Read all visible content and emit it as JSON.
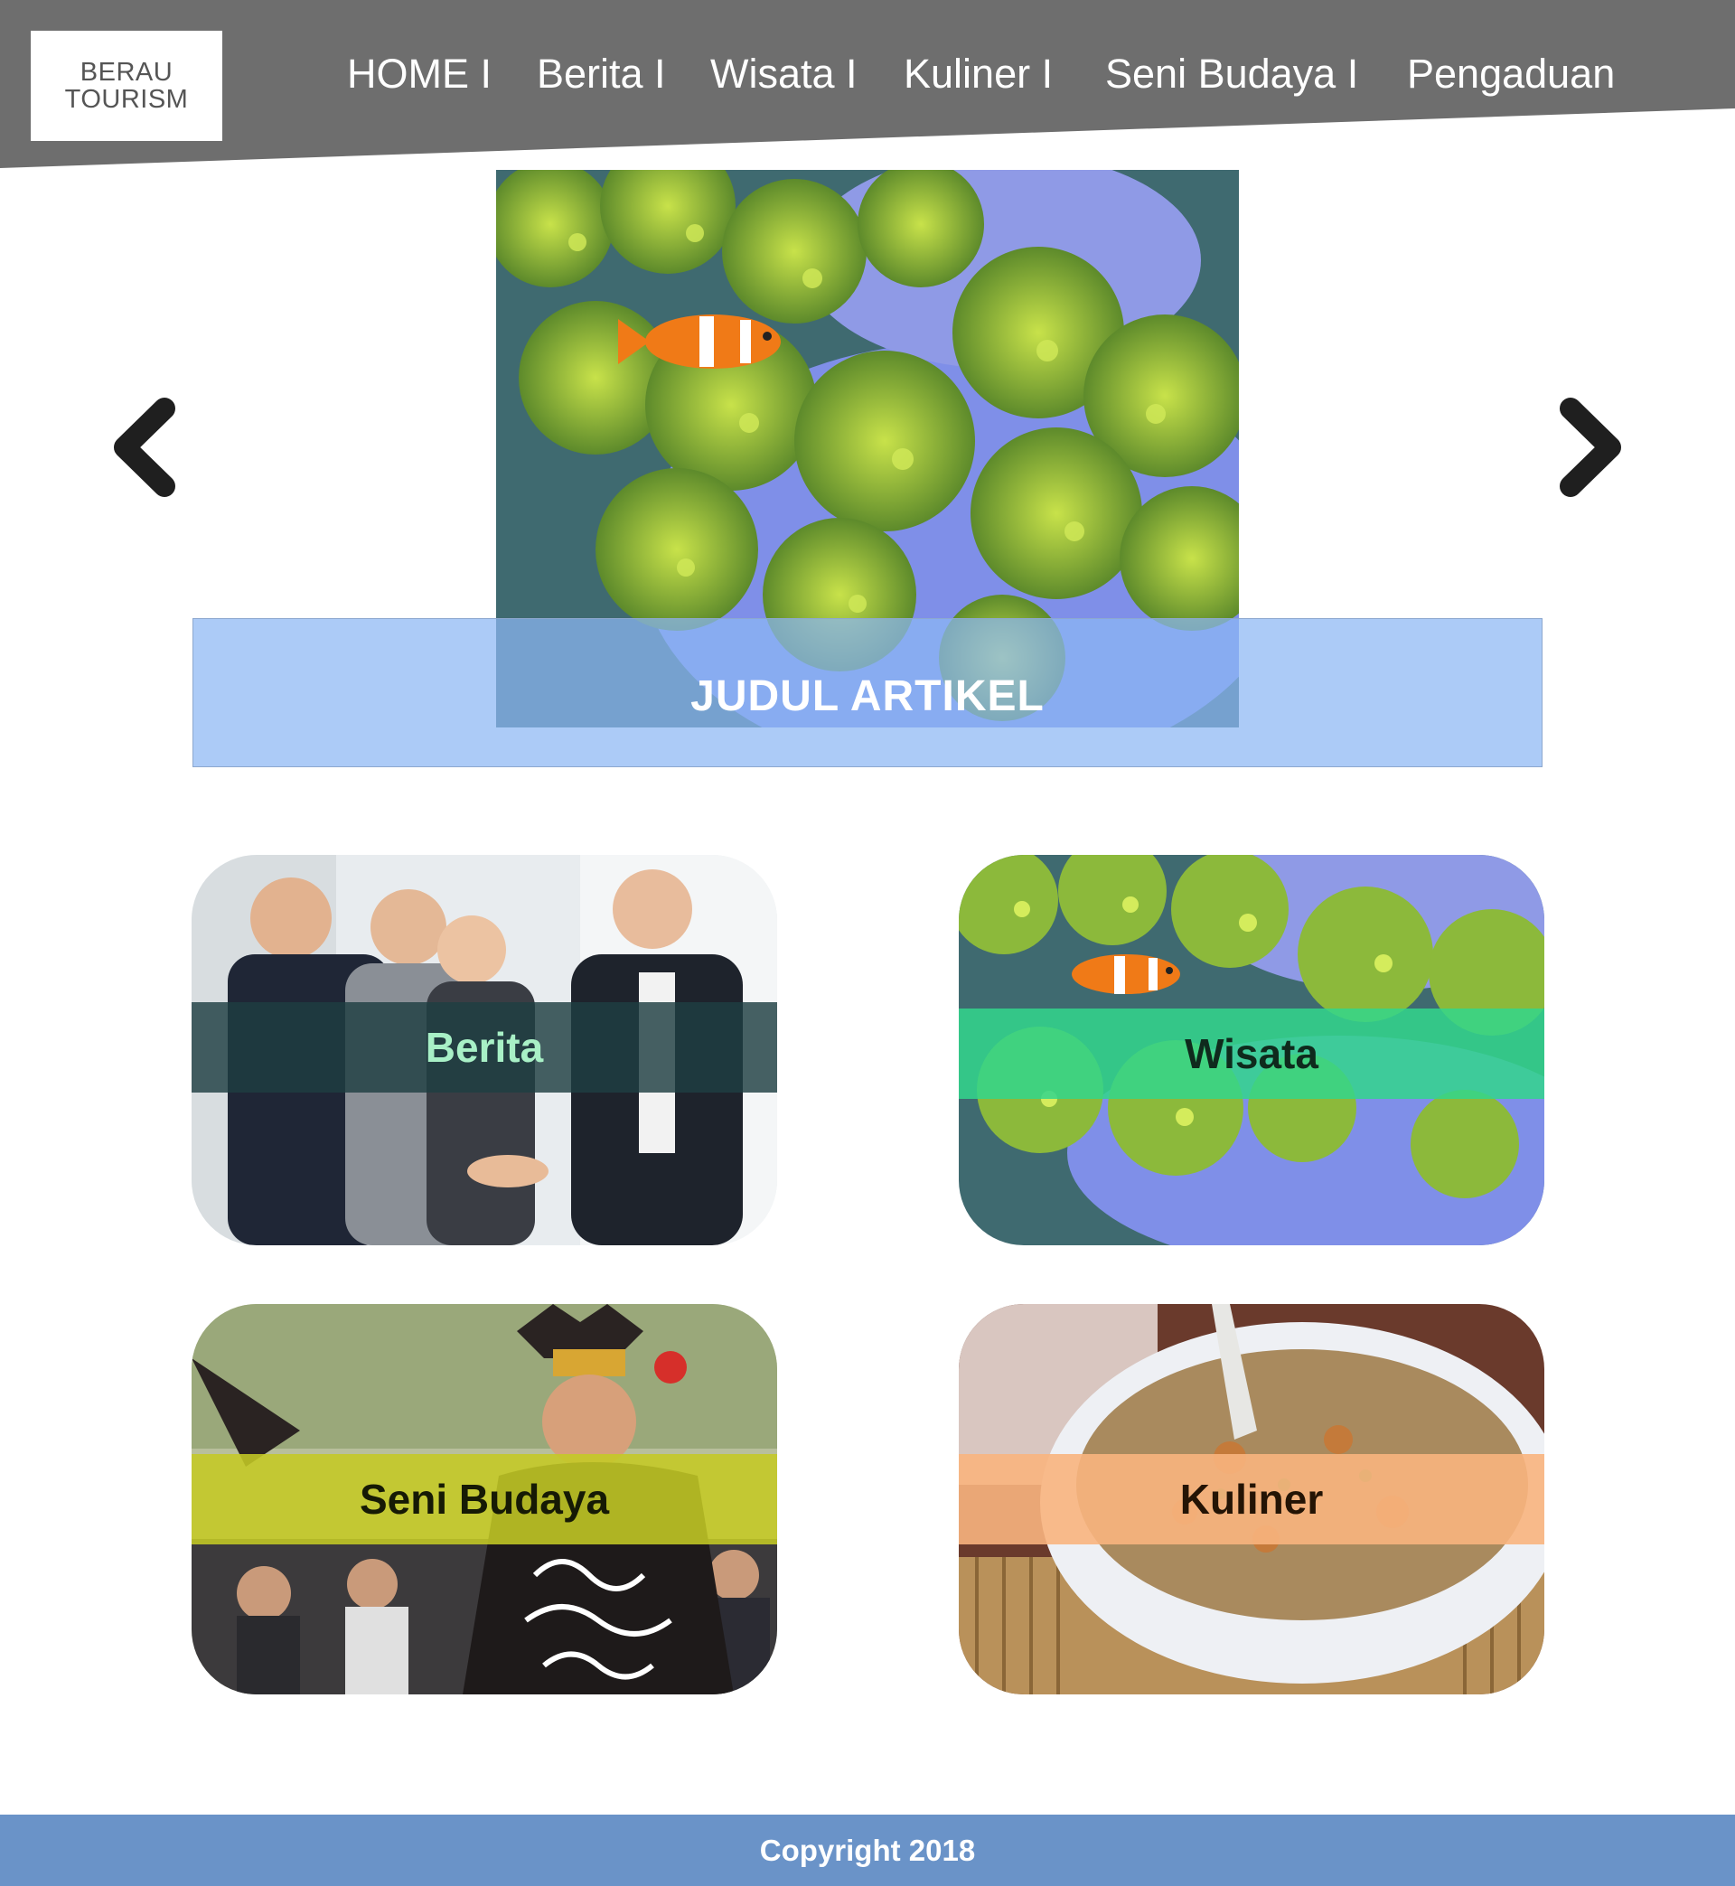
{
  "brand": {
    "line1": "BERAU",
    "line2": "TOURISM"
  },
  "nav": {
    "items": [
      {
        "label": "HOME I"
      },
      {
        "label": "Berita I"
      },
      {
        "label": "Wisata I"
      },
      {
        "label": "Kuliner I"
      },
      {
        "label": "Seni Budaya I"
      },
      {
        "label": "Pengaduan"
      }
    ]
  },
  "slider": {
    "title": "JUDUL ARTIKEL",
    "prev_icon": "chevron-left-icon",
    "next_icon": "chevron-right-icon",
    "image": "clownfish-anemone-photo"
  },
  "categories": [
    {
      "label": "Berita",
      "image": "business-handshake-photo",
      "band_color": "#2a4a4e",
      "text_color": "#a8f0c6"
    },
    {
      "label": "Wisata",
      "image": "clownfish-anemone-photo",
      "band_color": "#3fd08e",
      "text_color": "#0f2a1d"
    },
    {
      "label": "Seni Budaya",
      "image": "dayak-dancer-photo",
      "band_color": "#c7cd2a",
      "text_color": "#161a05"
    },
    {
      "label": "Kuliner",
      "image": "soup-bowl-photo",
      "band_color": "#f5b07c",
      "text_color": "#241405"
    }
  ],
  "footer": {
    "copyright": "Copyright 2018"
  },
  "colors": {
    "header": "#6e6e6e",
    "hero_band": "#9cc0f2",
    "footer": "#6a93c8"
  }
}
